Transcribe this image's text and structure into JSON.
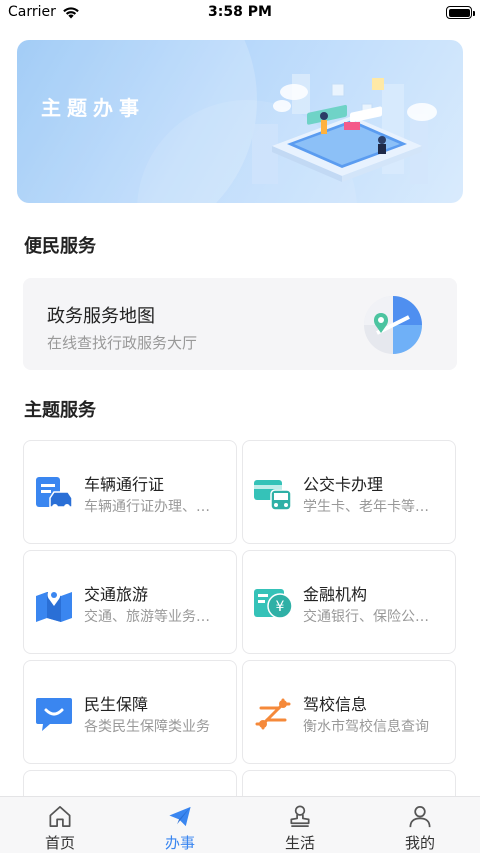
{
  "status_bar": {
    "carrier": "Carrier",
    "time": "3:58 PM"
  },
  "banner": {
    "title": "主题办事"
  },
  "convenience": {
    "section_title": "便民服务",
    "map_card": {
      "title": "政务服务地图",
      "subtitle": "在线查找行政服务大厅",
      "icon": "map-pin-icon"
    }
  },
  "topics": {
    "section_title": "主题服务",
    "items": [
      {
        "name": "车辆通行证",
        "desc": "车辆通行证办理、…",
        "icon": "vehicle-pass-icon",
        "color": "#3a86f0"
      },
      {
        "name": "公交卡办理",
        "desc": "学生卡、老年卡等…",
        "icon": "bus-card-icon",
        "color": "#35c2b8"
      },
      {
        "name": "交通旅游",
        "desc": "交通、旅游等业务…",
        "icon": "travel-map-icon",
        "color": "#3a86f0"
      },
      {
        "name": "金融机构",
        "desc": "交通银行、保险公…",
        "icon": "finance-icon",
        "color": "#35c2b8"
      },
      {
        "name": "民生保障",
        "desc": "各类民生保障类业务",
        "icon": "chat-smile-icon",
        "color": "#3a86f0"
      },
      {
        "name": "驾校信息",
        "desc": "衡水市驾校信息查询",
        "icon": "driving-school-icon",
        "color": "#f5893a"
      }
    ]
  },
  "tab_bar": {
    "active_color": "#3a86f0",
    "tabs": [
      {
        "label": "首页",
        "icon": "home-icon",
        "active": false
      },
      {
        "label": "办事",
        "icon": "paper-plane-icon",
        "active": true
      },
      {
        "label": "生活",
        "icon": "stamp-icon",
        "active": false
      },
      {
        "label": "我的",
        "icon": "user-icon",
        "active": false
      }
    ]
  }
}
